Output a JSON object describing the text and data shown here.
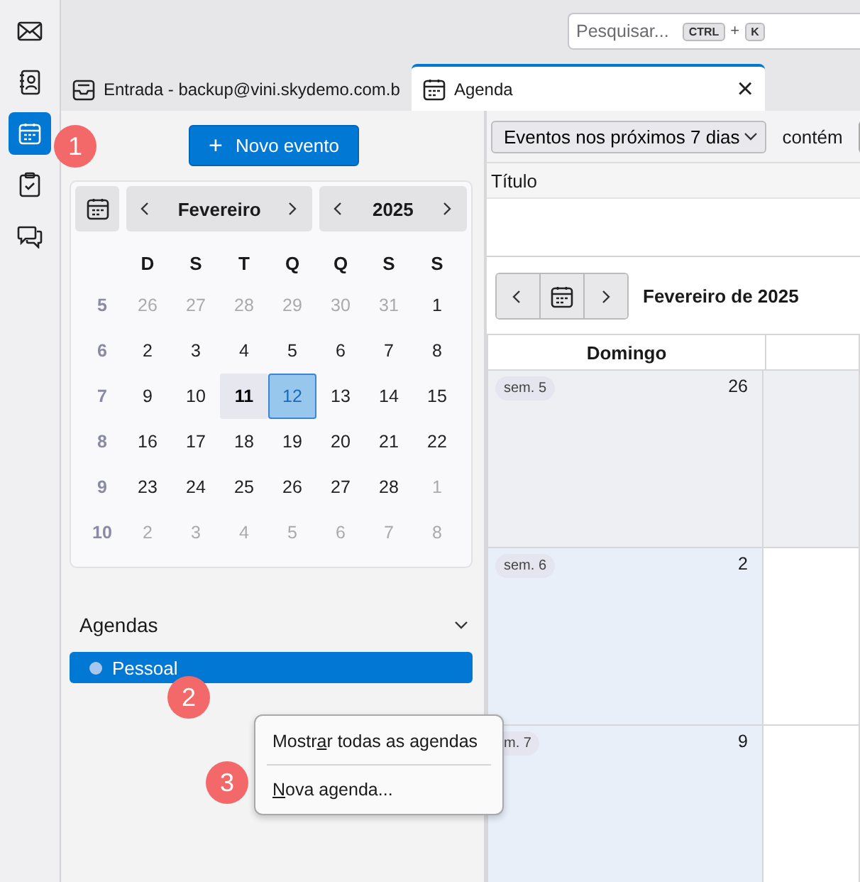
{
  "rail": [
    {
      "selected": false
    },
    {
      "selected": false
    },
    {
      "selected": true
    },
    {
      "selected": false
    },
    {
      "selected": false
    }
  ],
  "search": {
    "placeholder": "Pesquisar...",
    "keys": [
      "CTRL",
      "K"
    ],
    "joiner": "+"
  },
  "tabs": [
    {
      "label": "Entrada - backup@vini.skydemo.com.b",
      "selected": false
    },
    {
      "label": "Agenda",
      "selected": true,
      "close": "×"
    }
  ],
  "sidebar": {
    "new_event": {
      "icon": "+",
      "label": "Novo evento"
    },
    "mini_calendar": {
      "month": "Fevereiro",
      "year": "2025",
      "weekdays": [
        "D",
        "S",
        "T",
        "Q",
        "Q",
        "S",
        "S"
      ],
      "weeks": [
        {
          "number": "5",
          "days": [
            {
              "d": "26",
              "outside": true,
              "today": false,
              "selected": false
            },
            {
              "d": "27",
              "outside": true,
              "today": false,
              "selected": false
            },
            {
              "d": "28",
              "outside": true,
              "today": false,
              "selected": false
            },
            {
              "d": "29",
              "outside": true,
              "today": false,
              "selected": false
            },
            {
              "d": "30",
              "outside": true,
              "today": false,
              "selected": false
            },
            {
              "d": "31",
              "outside": true,
              "today": false,
              "selected": false
            },
            {
              "d": "1",
              "outside": false,
              "today": false,
              "selected": false
            }
          ]
        },
        {
          "number": "6",
          "days": [
            {
              "d": "2",
              "outside": false,
              "today": false,
              "selected": false
            },
            {
              "d": "3",
              "outside": false,
              "today": false,
              "selected": false
            },
            {
              "d": "4",
              "outside": false,
              "today": false,
              "selected": false
            },
            {
              "d": "5",
              "outside": false,
              "today": false,
              "selected": false
            },
            {
              "d": "6",
              "outside": false,
              "today": false,
              "selected": false
            },
            {
              "d": "7",
              "outside": false,
              "today": false,
              "selected": false
            },
            {
              "d": "8",
              "outside": false,
              "today": false,
              "selected": false
            }
          ]
        },
        {
          "number": "7",
          "days": [
            {
              "d": "9",
              "outside": false,
              "today": false,
              "selected": false
            },
            {
              "d": "10",
              "outside": false,
              "today": false,
              "selected": false
            },
            {
              "d": "11",
              "outside": false,
              "today": true,
              "selected": false
            },
            {
              "d": "12",
              "outside": false,
              "today": false,
              "selected": true
            },
            {
              "d": "13",
              "outside": false,
              "today": false,
              "selected": false
            },
            {
              "d": "14",
              "outside": false,
              "today": false,
              "selected": false
            },
            {
              "d": "15",
              "outside": false,
              "today": false,
              "selected": false
            }
          ]
        },
        {
          "number": "8",
          "days": [
            {
              "d": "16",
              "outside": false,
              "today": false,
              "selected": false
            },
            {
              "d": "17",
              "outside": false,
              "today": false,
              "selected": false
            },
            {
              "d": "18",
              "outside": false,
              "today": false,
              "selected": false
            },
            {
              "d": "19",
              "outside": false,
              "today": false,
              "selected": false
            },
            {
              "d": "20",
              "outside": false,
              "today": false,
              "selected": false
            },
            {
              "d": "21",
              "outside": false,
              "today": false,
              "selected": false
            },
            {
              "d": "22",
              "outside": false,
              "today": false,
              "selected": false
            }
          ]
        },
        {
          "number": "9",
          "days": [
            {
              "d": "23",
              "outside": false,
              "today": false,
              "selected": false
            },
            {
              "d": "24",
              "outside": false,
              "today": false,
              "selected": false
            },
            {
              "d": "25",
              "outside": false,
              "today": false,
              "selected": false
            },
            {
              "d": "26",
              "outside": false,
              "today": false,
              "selected": false
            },
            {
              "d": "27",
              "outside": false,
              "today": false,
              "selected": false
            },
            {
              "d": "28",
              "outside": false,
              "today": false,
              "selected": false
            },
            {
              "d": "1",
              "outside": true,
              "today": false,
              "selected": false
            }
          ]
        },
        {
          "number": "10",
          "days": [
            {
              "d": "2",
              "outside": true,
              "today": false,
              "selected": false
            },
            {
              "d": "3",
              "outside": true,
              "today": false,
              "selected": false
            },
            {
              "d": "4",
              "outside": true,
              "today": false,
              "selected": false
            },
            {
              "d": "5",
              "outside": true,
              "today": false,
              "selected": false
            },
            {
              "d": "6",
              "outside": true,
              "today": false,
              "selected": false
            },
            {
              "d": "7",
              "outside": true,
              "today": false,
              "selected": false
            },
            {
              "d": "8",
              "outside": true,
              "today": false,
              "selected": false
            }
          ]
        }
      ]
    },
    "calendars": {
      "title": "Agendas",
      "expanded": true,
      "items": [
        {
          "name": "Pessoal",
          "selected": true,
          "color": "#a9c7ec"
        }
      ]
    }
  },
  "main": {
    "filter": {
      "value": "Eventos nos próximos 7 dias",
      "contains_label": "contém"
    },
    "list_columns": [
      "Título"
    ],
    "view": {
      "title": "Fevereiro de 2025",
      "columns": [
        {
          "label": "Domingo"
        },
        {}
      ],
      "weeks": [
        {
          "label": "sem. 5",
          "days": [
            {
              "d": "26",
              "kind": "outside"
            },
            {
              "kind": "outside"
            }
          ]
        },
        {
          "label": "sem. 6",
          "days": [
            {
              "d": "2",
              "kind": "weekend"
            },
            {
              "kind": "weekday"
            }
          ]
        },
        {
          "label": "m. 7",
          "days": [
            {
              "d": "9",
              "kind": "weekend"
            },
            {
              "kind": "weekday"
            }
          ]
        }
      ]
    }
  },
  "context_menu": {
    "items": [
      {
        "before": "Mostr",
        "key": "a",
        "after": "r todas as agendas"
      },
      {
        "key": "N",
        "after": "ova agenda..."
      }
    ]
  },
  "annotations": [
    "1",
    "2",
    "3"
  ]
}
